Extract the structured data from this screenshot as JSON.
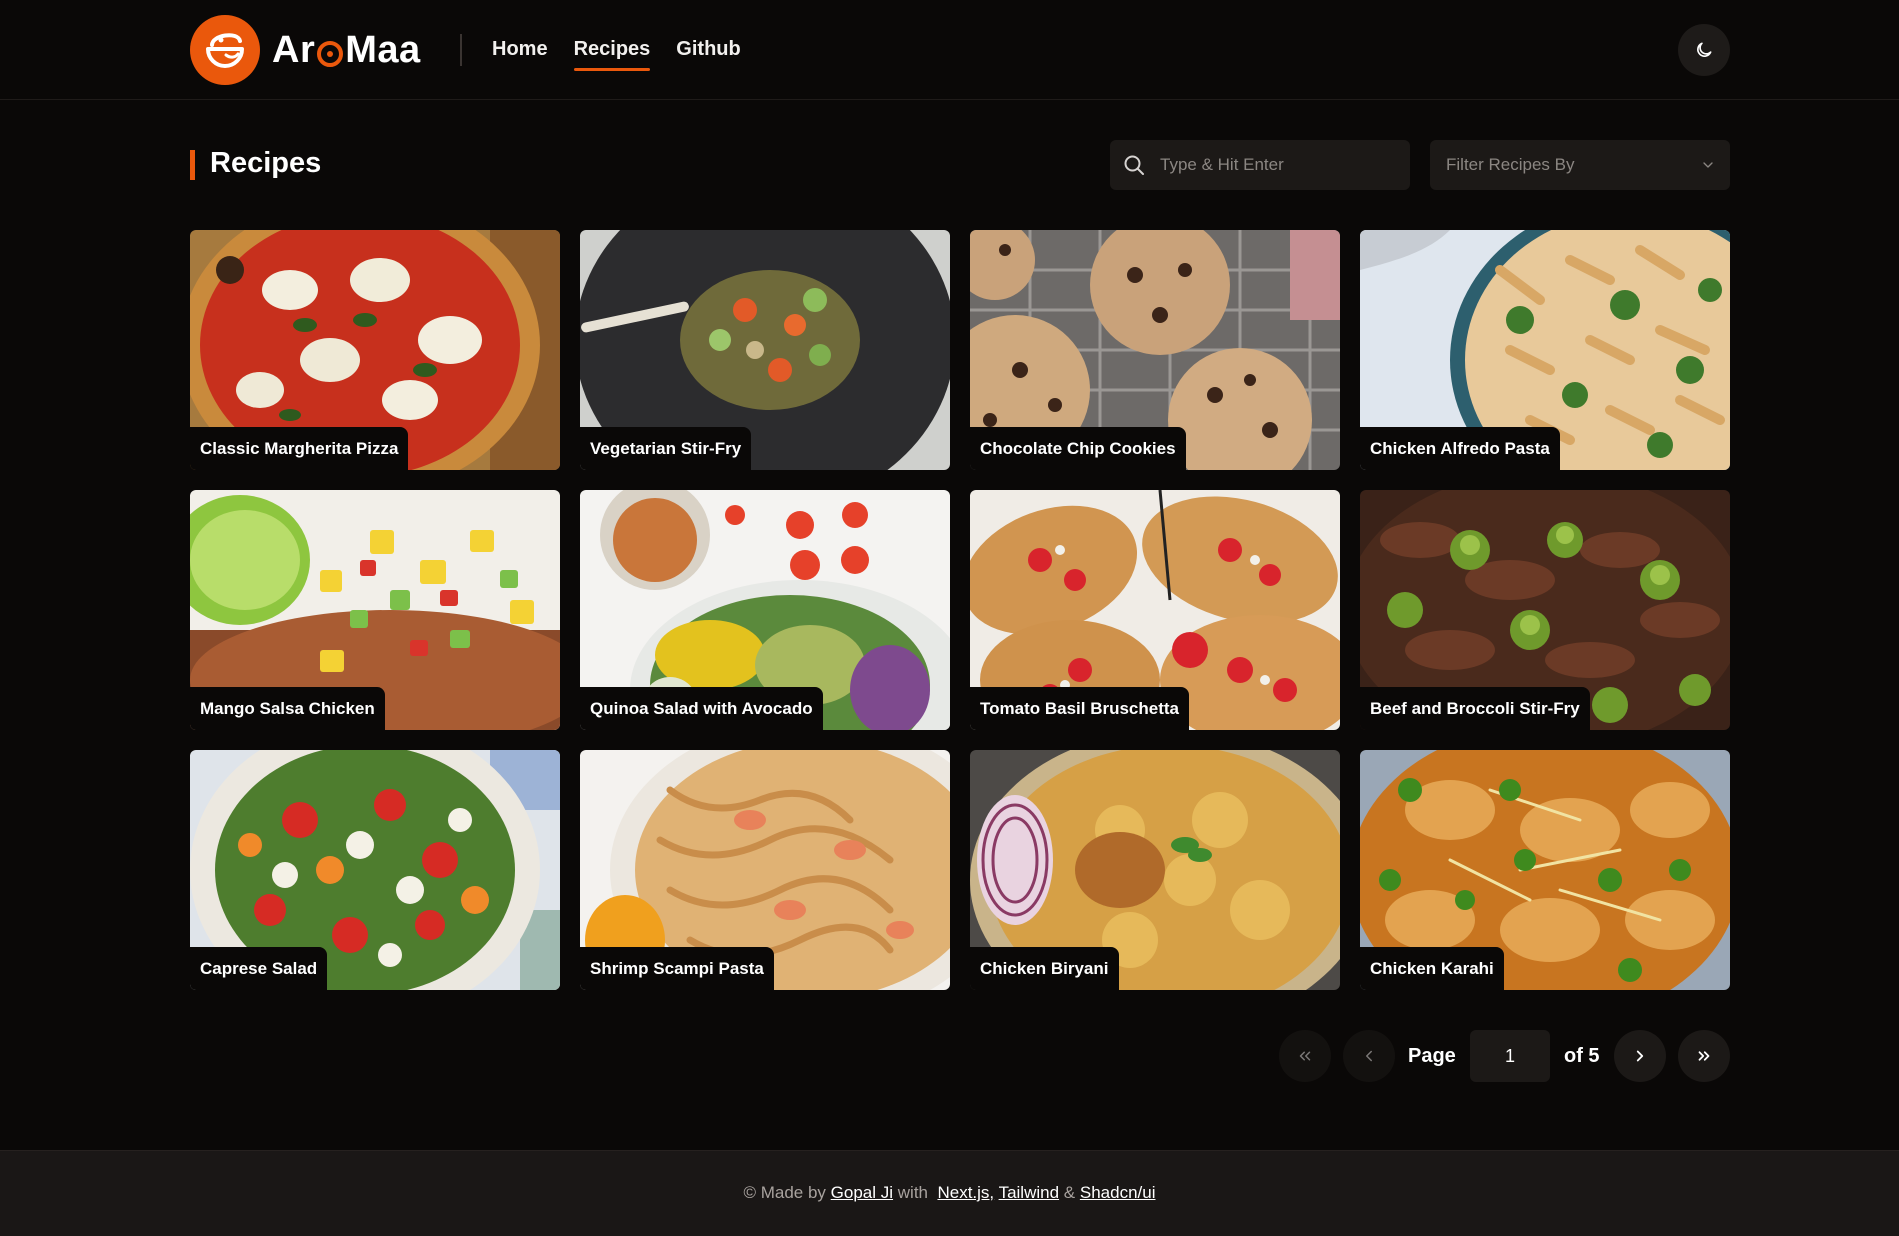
{
  "header": {
    "logo_text_left": "Ar",
    "logo_text_right": "Maa",
    "nav": [
      {
        "label": "Home"
      },
      {
        "label": "Recipes"
      },
      {
        "label": "Github"
      }
    ]
  },
  "main": {
    "title": "Recipes",
    "search_placeholder": "Type & Hit Enter",
    "filter_label": "Filter Recipes By"
  },
  "recipes": [
    {
      "name": "Classic Margherita Pizza"
    },
    {
      "name": "Vegetarian Stir-Fry"
    },
    {
      "name": "Chocolate Chip Cookies"
    },
    {
      "name": "Chicken Alfredo Pasta"
    },
    {
      "name": "Mango Salsa Chicken"
    },
    {
      "name": "Quinoa Salad with Avocado"
    },
    {
      "name": "Tomato Basil Bruschetta"
    },
    {
      "name": "Beef and Broccoli Stir-Fry"
    },
    {
      "name": "Caprese Salad"
    },
    {
      "name": "Shrimp Scampi Pasta"
    },
    {
      "name": "Chicken Biryani"
    },
    {
      "name": "Chicken Karahi"
    }
  ],
  "pagination": {
    "page_label": "Page",
    "current_page": "1",
    "of_label": "of 5"
  },
  "footer": {
    "prefix": "© Made by",
    "author": "Gopal Ji",
    "with": "with",
    "tech1": "Next.js,",
    "tech2": "Tailwind",
    "amp": "&",
    "tech3": "Shadcn/ui"
  },
  "colors": {
    "accent": "#ea580c",
    "background": "#0a0807",
    "surface": "#1c1917"
  }
}
